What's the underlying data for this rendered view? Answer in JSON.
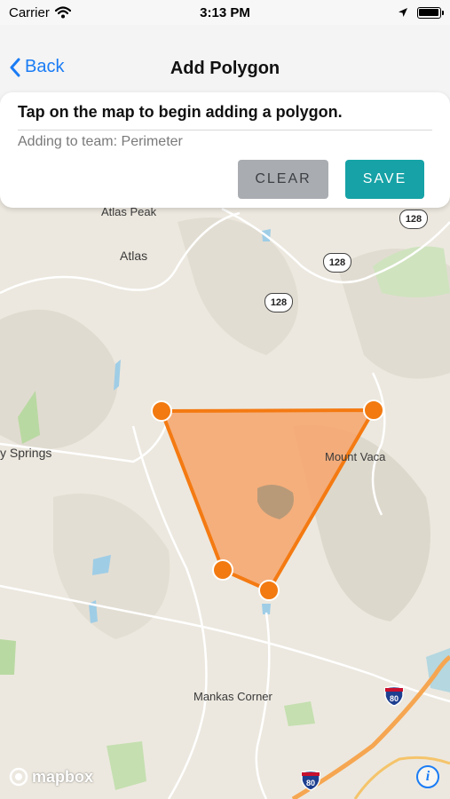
{
  "status_bar": {
    "carrier": "Carrier",
    "time": "3:13 PM"
  },
  "nav": {
    "back_label": "Back",
    "title": "Add Polygon"
  },
  "card": {
    "instruction": "Tap on the map to begin adding a polygon.",
    "team_text": "Adding to team: Perimeter",
    "clear_label": "CLEAR",
    "save_label": "SAVE"
  },
  "map": {
    "place_labels": {
      "atlas_peak": "Atlas Peak",
      "atlas": "Atlas",
      "springs": "y Springs",
      "mount_vaca": "Mount Vaca",
      "mankas_corner": "Mankas Corner"
    },
    "route_shields": {
      "r1": "128",
      "r2": "128",
      "r3": "128"
    },
    "interstate_shields": {
      "i1": "80",
      "i2": "80"
    },
    "attribution": "mapbox",
    "info_symbol": "i"
  },
  "colors": {
    "polygon_fill": "#f7a46b",
    "polygon_stroke": "#f47a12",
    "vertex": "#f27a10",
    "save_button": "#16a2a6",
    "clear_button": "#a9adb2",
    "accent": "#1a7cf5"
  }
}
